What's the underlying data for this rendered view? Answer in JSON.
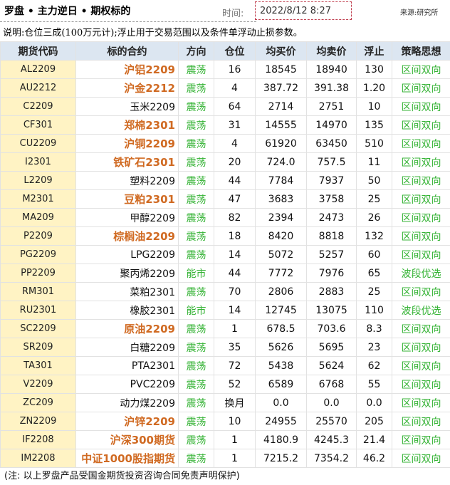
{
  "header": {
    "title": "罗盘 • 主力逆日 • 期权标的",
    "time_label": "时间:",
    "time_value": "2022/8/12 8:27",
    "source": "来源:研究所"
  },
  "description": "说明:仓位三成(100万元计);浮止用于交易范围以及条件单浮动止损参数。",
  "table": {
    "headers": [
      "期货代码",
      "标的合约",
      "方向",
      "仓位",
      "均买价",
      "均卖价",
      "浮止",
      "策略思想"
    ],
    "rows": [
      {
        "code": "AL2209",
        "name": "沪铝2209",
        "highlight": true,
        "direction": "震荡",
        "position": "16",
        "buy": "18545",
        "sell": "18940",
        "stop": "130",
        "strategy": "区间双向"
      },
      {
        "code": "AU2212",
        "name": "沪金2212",
        "highlight": true,
        "direction": "震荡",
        "position": "4",
        "buy": "387.72",
        "sell": "391.38",
        "stop": "1.20",
        "strategy": "区间双向"
      },
      {
        "code": "C2209",
        "name": "玉米2209",
        "highlight": false,
        "direction": "震荡",
        "position": "64",
        "buy": "2714",
        "sell": "2751",
        "stop": "10",
        "strategy": "区间双向"
      },
      {
        "code": "CF301",
        "name": "郑棉2301",
        "highlight": true,
        "direction": "震荡",
        "position": "31",
        "buy": "14555",
        "sell": "14970",
        "stop": "135",
        "strategy": "区间双向"
      },
      {
        "code": "CU2209",
        "name": "沪铜2209",
        "highlight": true,
        "direction": "震荡",
        "position": "4",
        "buy": "61920",
        "sell": "63450",
        "stop": "510",
        "strategy": "区间双向"
      },
      {
        "code": "I2301",
        "name": "铁矿石2301",
        "highlight": true,
        "direction": "震荡",
        "position": "20",
        "buy": "724.0",
        "sell": "757.5",
        "stop": "11",
        "strategy": "区间双向"
      },
      {
        "code": "L2209",
        "name": "塑料2209",
        "highlight": false,
        "direction": "震荡",
        "position": "44",
        "buy": "7784",
        "sell": "7937",
        "stop": "50",
        "strategy": "区间双向"
      },
      {
        "code": "M2301",
        "name": "豆粕2301",
        "highlight": true,
        "direction": "震荡",
        "position": "47",
        "buy": "3683",
        "sell": "3758",
        "stop": "25",
        "strategy": "区间双向"
      },
      {
        "code": "MA209",
        "name": "甲醇2209",
        "highlight": false,
        "direction": "震荡",
        "position": "82",
        "buy": "2394",
        "sell": "2473",
        "stop": "26",
        "strategy": "区间双向"
      },
      {
        "code": "P2209",
        "name": "棕榈油2209",
        "highlight": true,
        "direction": "震荡",
        "position": "18",
        "buy": "8420",
        "sell": "8818",
        "stop": "132",
        "strategy": "区间双向"
      },
      {
        "code": "PG2209",
        "name": "LPG2209",
        "highlight": false,
        "direction": "震荡",
        "position": "14",
        "buy": "5072",
        "sell": "5257",
        "stop": "60",
        "strategy": "区间双向"
      },
      {
        "code": "PP2209",
        "name": "聚丙烯2209",
        "highlight": false,
        "direction": "能市",
        "position": "44",
        "buy": "7772",
        "sell": "7976",
        "stop": "65",
        "strategy": "波段优选"
      },
      {
        "code": "RM301",
        "name": "菜粕2301",
        "highlight": false,
        "direction": "震荡",
        "position": "70",
        "buy": "2806",
        "sell": "2883",
        "stop": "25",
        "strategy": "区间双向"
      },
      {
        "code": "RU2301",
        "name": "橡胶2301",
        "highlight": false,
        "direction": "能市",
        "position": "14",
        "buy": "12745",
        "sell": "13075",
        "stop": "110",
        "strategy": "波段优选"
      },
      {
        "code": "SC2209",
        "name": "原油2209",
        "highlight": true,
        "direction": "震荡",
        "position": "1",
        "buy": "678.5",
        "sell": "703.6",
        "stop": "8.3",
        "strategy": "区间双向"
      },
      {
        "code": "SR209",
        "name": "白糖2209",
        "highlight": false,
        "direction": "震荡",
        "position": "35",
        "buy": "5626",
        "sell": "5695",
        "stop": "23",
        "strategy": "区间双向"
      },
      {
        "code": "TA301",
        "name": "PTA2301",
        "highlight": false,
        "direction": "震荡",
        "position": "72",
        "buy": "5438",
        "sell": "5624",
        "stop": "62",
        "strategy": "区间双向"
      },
      {
        "code": "V2209",
        "name": "PVC2209",
        "highlight": false,
        "direction": "震荡",
        "position": "52",
        "buy": "6589",
        "sell": "6768",
        "stop": "55",
        "strategy": "区间双向"
      },
      {
        "code": "ZC209",
        "name": "动力煤2209",
        "highlight": false,
        "direction": "震荡",
        "position": "换月",
        "buy": "0.0",
        "sell": "0.0",
        "stop": "0.0",
        "strategy": "区间双向"
      },
      {
        "code": "ZN2209",
        "name": "沪锌2209",
        "highlight": true,
        "direction": "震荡",
        "position": "10",
        "buy": "24955",
        "sell": "25570",
        "stop": "205",
        "strategy": "区间双向"
      },
      {
        "code": "IF2208",
        "name": "沪深300期货",
        "highlight": true,
        "direction": "震荡",
        "position": "1",
        "buy": "4180.9",
        "sell": "4245.3",
        "stop": "21.4",
        "strategy": "区间双向"
      },
      {
        "code": "IM2208",
        "name": "中证1000股指期货",
        "highlight": true,
        "direction": "震荡",
        "position": "1",
        "buy": "7215.2",
        "sell": "7354.2",
        "stop": "46.2",
        "strategy": "区间双向"
      }
    ]
  },
  "footnote": "(注: 以上罗盘产品受国金期货投资咨询合同免责声明保护)",
  "colors": {
    "header_bg": "#dce6f1",
    "code_bg": "#fff3c4",
    "highlight_name": "#d06a22",
    "direction_green": "#35b335",
    "time_border": "#c04050"
  }
}
